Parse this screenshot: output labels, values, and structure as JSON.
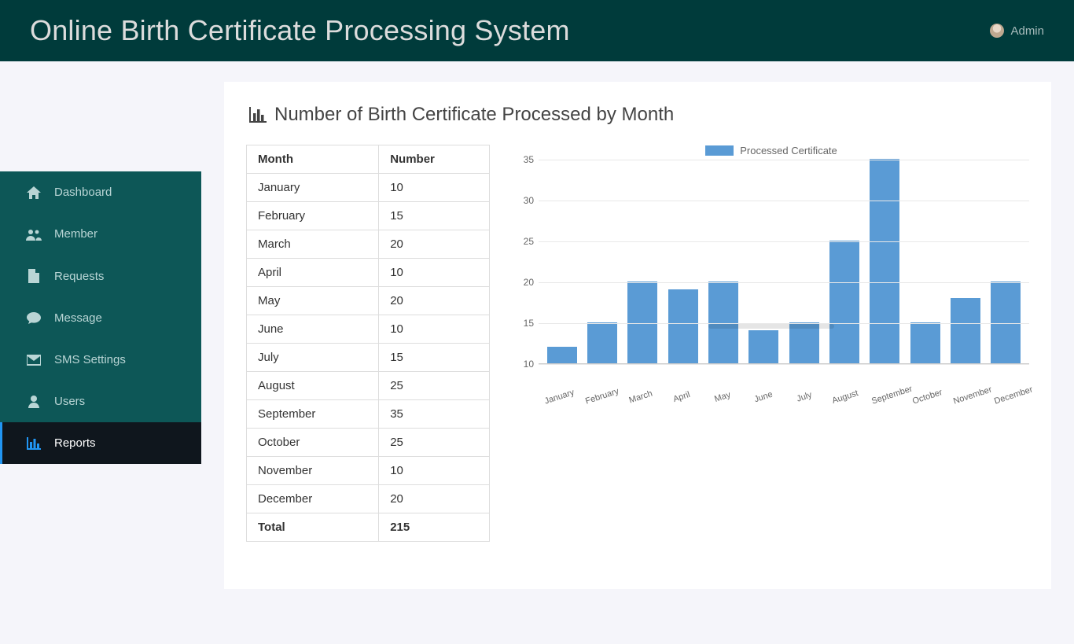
{
  "header": {
    "title": "Online Birth Certificate Processing System",
    "user_label": "Admin"
  },
  "sidebar": {
    "items": [
      {
        "label": "Dashboard",
        "icon": "home-icon",
        "active": false
      },
      {
        "label": "Member",
        "icon": "users-icon",
        "active": false
      },
      {
        "label": "Requests",
        "icon": "file-icon",
        "active": false
      },
      {
        "label": "Message",
        "icon": "comment-icon",
        "active": false
      },
      {
        "label": "SMS Settings",
        "icon": "envelope-icon",
        "active": false
      },
      {
        "label": "Users",
        "icon": "user-icon",
        "active": false
      },
      {
        "label": "Reports",
        "icon": "bar-chart-icon",
        "active": true
      }
    ]
  },
  "panel": {
    "title": "Number of Birth Certificate Processed by Month"
  },
  "table": {
    "headers": {
      "month": "Month",
      "number": "Number"
    },
    "rows": [
      {
        "month": "January",
        "number": "10"
      },
      {
        "month": "February",
        "number": "15"
      },
      {
        "month": "March",
        "number": "20"
      },
      {
        "month": "April",
        "number": "10"
      },
      {
        "month": "May",
        "number": "20"
      },
      {
        "month": "June",
        "number": "10"
      },
      {
        "month": "July",
        "number": "15"
      },
      {
        "month": "August",
        "number": "25"
      },
      {
        "month": "September",
        "number": "35"
      },
      {
        "month": "October",
        "number": "25"
      },
      {
        "month": "November",
        "number": "10"
      },
      {
        "month": "December",
        "number": "20"
      }
    ],
    "total": {
      "label": "Total",
      "value": "215"
    }
  },
  "chart_data": {
    "type": "bar",
    "title": "",
    "legend": "Processed Certificate",
    "categories": [
      "January",
      "February",
      "March",
      "April",
      "May",
      "June",
      "July",
      "August",
      "September",
      "October",
      "November",
      "December"
    ],
    "values": [
      12,
      15,
      20,
      19,
      20,
      14,
      15,
      25,
      35,
      15,
      18,
      20
    ],
    "ylim": [
      10,
      35
    ],
    "y_ticks": [
      10,
      15,
      20,
      25,
      30,
      35
    ],
    "xlabel": "",
    "ylabel": ""
  },
  "colors": {
    "header_bg": "#003b3b",
    "sidebar_bg": "#0d5757",
    "active_bg": "#0f161d",
    "accent": "#2196f3",
    "bar": "#5a9bd5"
  }
}
